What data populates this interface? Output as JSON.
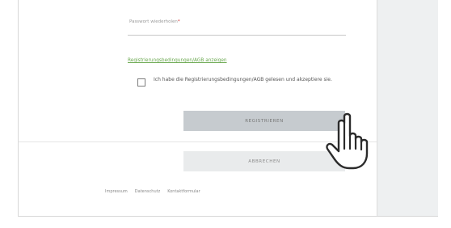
{
  "form": {
    "password_repeat_label": "Passwort wiederholen",
    "password_repeat_required_mark": "*",
    "terms_link": "Registrierungsbedingungen/AGB anzeigen",
    "accept_terms_text": "Ich habe die Registrierungsbedingungen/AGB gelesen und akzeptiere sie.",
    "accept_terms_checked": false,
    "register_button": "REGISTRIEREN",
    "cancel_button": "ABBRECHEN"
  },
  "footer": {
    "links": [
      "Impressum",
      "Datenschutz",
      "Kontaktformular"
    ]
  },
  "colors": {
    "link_green": "#6aa84f",
    "register_bg": "#c6cbcf",
    "cancel_bg": "#e9ebec",
    "side_panel_bg": "#eef0f1"
  },
  "icons": {
    "cursor": "hand-pointer-icon"
  }
}
